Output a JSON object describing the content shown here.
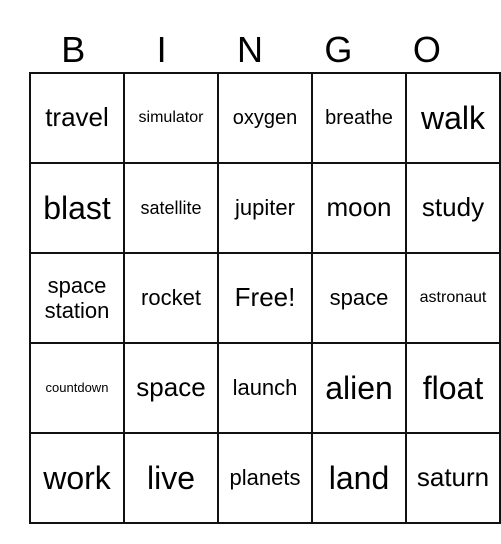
{
  "header": {
    "letters": [
      "B",
      "I",
      "N",
      "G",
      "O"
    ]
  },
  "board": {
    "rows": [
      [
        "travel",
        "simulator",
        "oxygen",
        "breathe",
        "walk"
      ],
      [
        "blast",
        "satellite",
        "jupiter",
        "moon",
        "study"
      ],
      [
        "space station",
        "rocket",
        "Free!",
        "space",
        "astronaut"
      ],
      [
        "countdown",
        "space",
        "launch",
        "alien",
        "float"
      ],
      [
        "work",
        "live",
        "planets",
        "land",
        "saturn"
      ]
    ]
  }
}
